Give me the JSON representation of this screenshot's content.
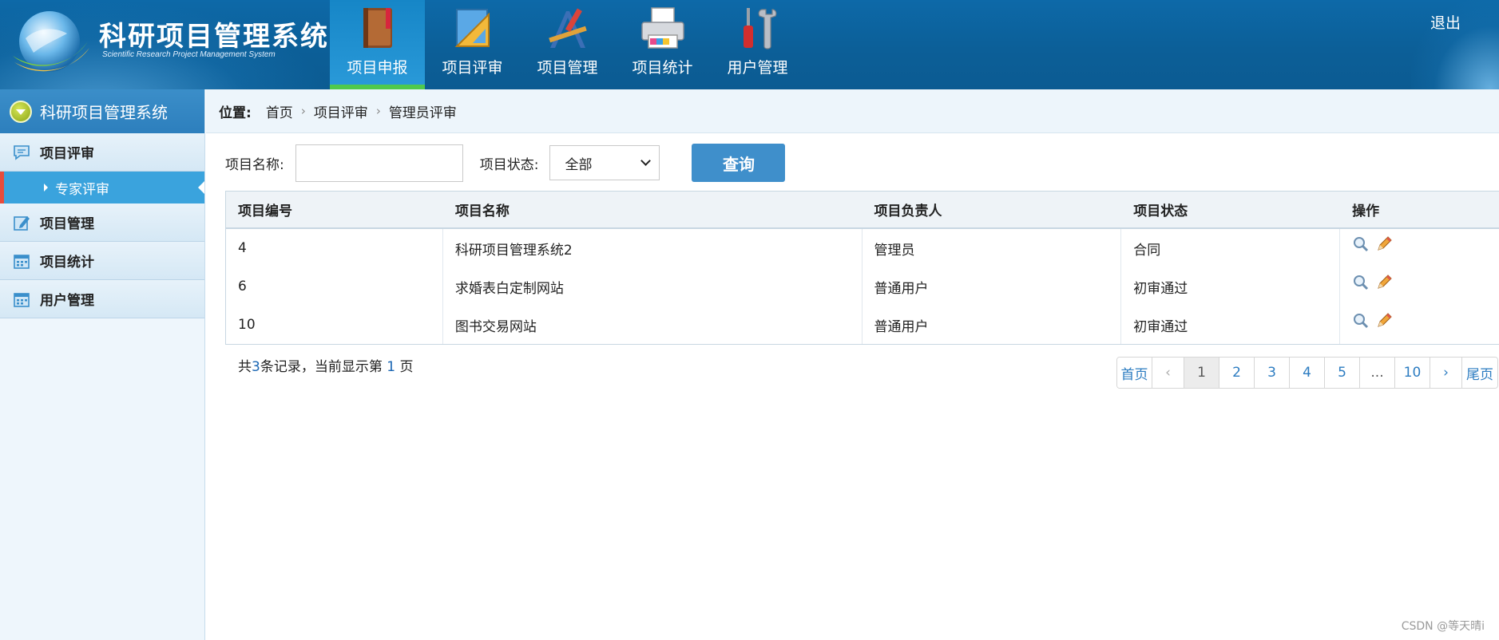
{
  "header": {
    "title": "科研项目管理系统",
    "subtitle": "Scientific Research Project Management System",
    "logout_label": "退出",
    "nav": [
      {
        "label": "项目申报",
        "icon": "book-icon",
        "active": true
      },
      {
        "label": "项目评审",
        "icon": "ruler-icon",
        "active": false
      },
      {
        "label": "项目管理",
        "icon": "drafting-tools-icon",
        "active": false
      },
      {
        "label": "项目统计",
        "icon": "printer-icon",
        "active": false
      },
      {
        "label": "用户管理",
        "icon": "wrench-screwdriver-icon",
        "active": false
      }
    ]
  },
  "sidebar": {
    "title": "科研项目管理系统",
    "sections": [
      {
        "label": "项目评审",
        "icon": "comment-icon"
      },
      {
        "label": "专家评审"
      },
      {
        "label": "项目管理",
        "icon": "edit-icon"
      },
      {
        "label": "项目统计",
        "icon": "calendar-icon"
      },
      {
        "label": "用户管理",
        "icon": "calendar-icon"
      }
    ]
  },
  "breadcrumb": {
    "label": "位置:",
    "items": [
      "首页",
      "项目评审",
      "管理员评审"
    ]
  },
  "filter": {
    "name_label": "项目名称:",
    "name_value": "",
    "status_label": "项目状态:",
    "status_value": "全部",
    "search_button": "查询"
  },
  "table": {
    "columns": [
      "项目编号",
      "项目名称",
      "项目负责人",
      "项目状态",
      "操作"
    ],
    "rows": [
      [
        "4",
        "科研项目管理系统2",
        "管理员",
        "合同"
      ],
      [
        "6",
        "求婚表白定制网站",
        "普通用户",
        "初审通过"
      ],
      [
        "10",
        "图书交易网站",
        "普通用户",
        "初审通过"
      ]
    ]
  },
  "summary": {
    "prefix": "共",
    "count": "3",
    "middle": "条记录，当前显示第",
    "page": "1",
    "suffix": "页"
  },
  "pager": {
    "first": "首页",
    "prev": "‹",
    "pages": [
      "1",
      "2",
      "3",
      "4",
      "5",
      "...",
      "10"
    ],
    "next": "›",
    "last": "尾页",
    "current": "1"
  },
  "watermark": "CSDN @等天晴i",
  "colors": {
    "header_bg": "#0c5f98",
    "accent": "#3f8fcb",
    "active_nav_underline": "#4fc94c",
    "sidebar_active": "#3aa3dd",
    "sidebar_marker": "#e74c3c"
  }
}
